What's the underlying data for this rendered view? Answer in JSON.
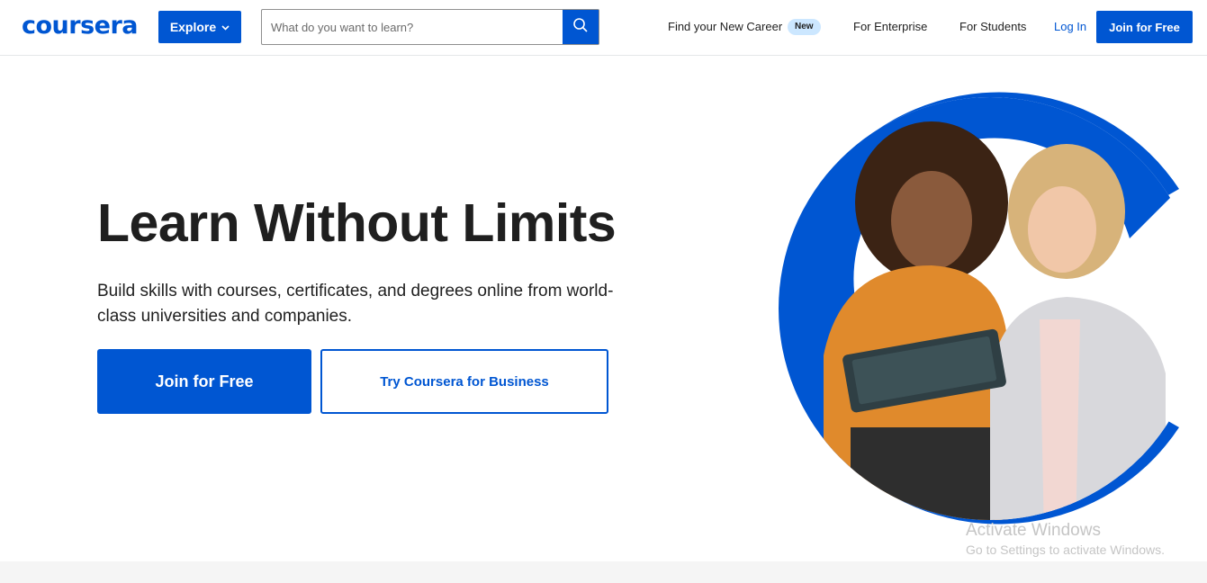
{
  "header": {
    "logo_text": "coursera",
    "explore_label": "Explore",
    "search": {
      "placeholder": "What do you want to learn?",
      "value": ""
    },
    "nav": {
      "find_career": "Find your New Career",
      "new_badge": "New",
      "enterprise": "For Enterprise",
      "students": "For Students",
      "login": "Log In",
      "join": "Join for Free"
    }
  },
  "hero": {
    "title": "Learn Without Limits",
    "subtitle": "Build skills with courses, certificates, and degrees online from world-class universities and companies.",
    "cta_primary": "Join for Free",
    "cta_secondary": "Try Coursera for Business",
    "image_description_icon": "people-with-tablet-photo"
  },
  "watermark": {
    "title": "Activate Windows",
    "subtitle": "Go to Settings to activate Windows."
  },
  "colors": {
    "brand_blue": "#0056d2",
    "badge_bg": "#cce7ff",
    "text": "#1f1f1f"
  }
}
